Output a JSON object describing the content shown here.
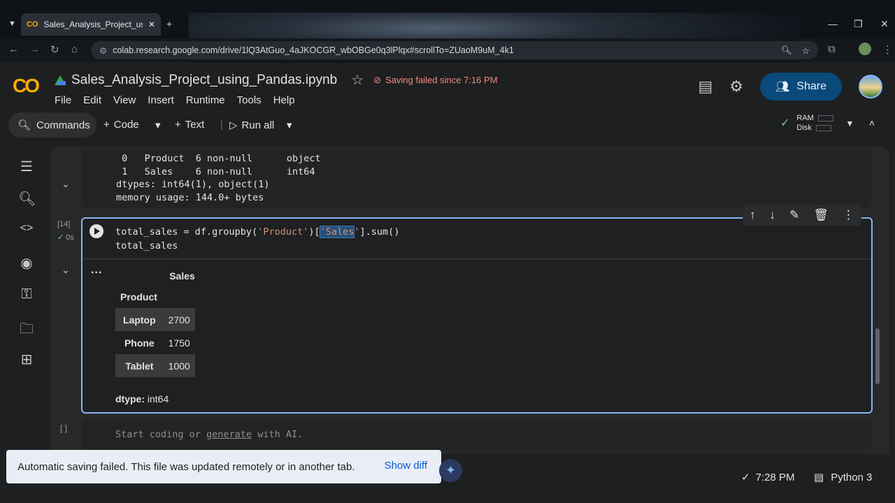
{
  "browser": {
    "tab_title": "Sales_Analysis_Project_using_Pa",
    "tab_favicon": "CO",
    "url": "colab.research.google.com/drive/1lQ3AtGuo_4aJKOCGR_wbOBGe0q3lPlqx#scrollTo=ZUaoM9uM_4k1"
  },
  "header": {
    "logo": "CO",
    "notebook_title": "Sales_Analysis_Project_using_Pandas.ipynb",
    "save_status": "Saving failed since 7:16 PM",
    "share_label": "Share",
    "menu": [
      "File",
      "Edit",
      "View",
      "Insert",
      "Runtime",
      "Tools",
      "Help"
    ]
  },
  "toolbar": {
    "commands_label": "Commands",
    "code_label": "Code",
    "text_label": "Text",
    "run_all_label": "Run all",
    "ram_label": "RAM",
    "disk_label": "Disk"
  },
  "previous_output": {
    "lines": [
      " 0   Product  6 non-null      object",
      " 1   Sales    6 non-null      int64",
      "dtypes: int64(1), object(1)",
      "memory usage: 144.0+ bytes"
    ]
  },
  "cell": {
    "execution_count": "[14]",
    "exec_time": "0s",
    "code_line1_a": "total_sales = df.groupby(",
    "code_line1_str1": "'Product'",
    "code_line1_b": ")[",
    "code_line1_str2": "'Sales",
    "code_line1_str3": "'",
    "code_line1_c": "].sum()",
    "code_line2": "total_sales",
    "output_dots": "...",
    "series": {
      "column_header": "Sales",
      "index_name": "Product",
      "rows": [
        {
          "index": "Laptop",
          "value": "2700"
        },
        {
          "index": "Phone",
          "value": "1750"
        },
        {
          "index": "Tablet",
          "value": "1000"
        }
      ],
      "dtype_label": "dtype:",
      "dtype_value": "int64"
    }
  },
  "empty_cell": {
    "execution_count": "[ ]",
    "placeholder_a": "Start coding or ",
    "placeholder_link": "generate",
    "placeholder_b": " with AI."
  },
  "toast": {
    "message": "Automatic saving failed. This file was updated remotely or in another tab.",
    "action": "Show diff"
  },
  "statusbar": {
    "time": "7:28 PM",
    "runtime": "Python 3"
  },
  "colors": {
    "accent": "#8ab4f8",
    "logo": "#f9ab00",
    "error": "#f28b82",
    "share_bg": "#0a4a7a",
    "string": "#ce9178"
  }
}
